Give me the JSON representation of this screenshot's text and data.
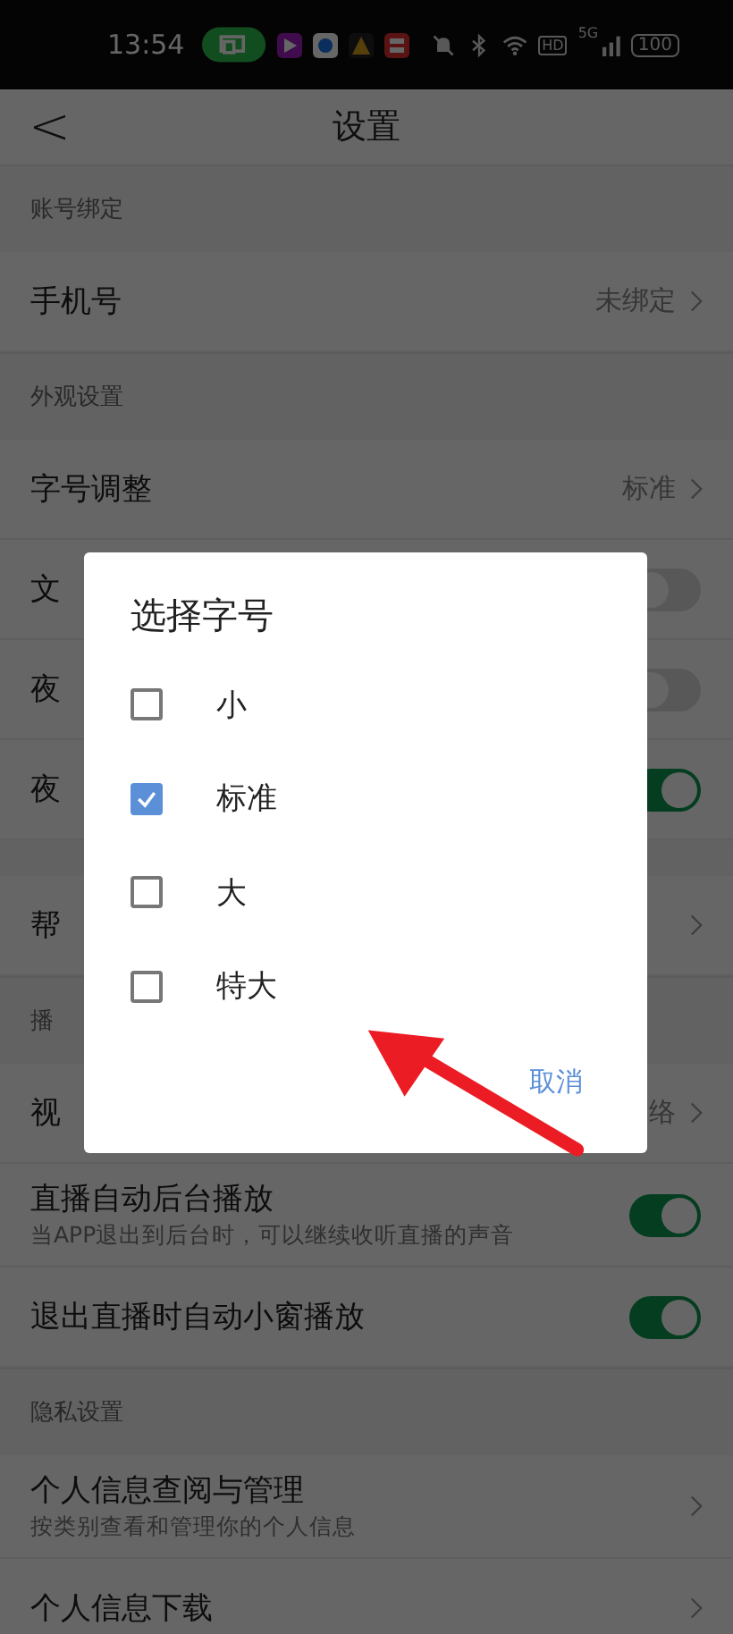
{
  "status_bar": {
    "time": "13:54",
    "hd": "HD",
    "network": "5G",
    "battery": "100"
  },
  "header": {
    "back": "<",
    "title": "设置"
  },
  "sections": [
    {
      "title": "账号绑定",
      "rows": [
        {
          "kind": "link",
          "label": "手机号",
          "value": "未绑定"
        }
      ]
    },
    {
      "title": "外观设置",
      "rows": [
        {
          "kind": "link",
          "label": "字号调整",
          "value": "标准"
        },
        {
          "kind": "toggle",
          "label": "文",
          "on": false
        },
        {
          "kind": "toggle",
          "label": "夜",
          "on": false
        },
        {
          "kind": "toggle",
          "label": "夜",
          "on": true
        }
      ]
    },
    {
      "rows": [
        {
          "kind": "link",
          "label": "帮"
        }
      ]
    },
    {
      "title": "播",
      "rows": [
        {
          "kind": "link",
          "label": "视",
          "value": "络"
        },
        {
          "kind": "toggle",
          "label": "直播自动后台播放",
          "sub": "当APP退出到后台时，可以继续收听直播的声音",
          "on": true
        },
        {
          "kind": "toggle",
          "label": "退出直播时自动小窗播放",
          "on": true
        }
      ]
    },
    {
      "title": "隐私设置",
      "rows": [
        {
          "kind": "link",
          "label": "个人信息查阅与管理",
          "sub": "按类别查看和管理你的个人信息"
        },
        {
          "kind": "link",
          "label": "个人信息下载"
        }
      ]
    }
  ],
  "dialog": {
    "title": "选择字号",
    "options": [
      {
        "label": "小",
        "selected": false
      },
      {
        "label": "标准",
        "selected": true
      },
      {
        "label": "大",
        "selected": false
      },
      {
        "label": "特大",
        "selected": false
      }
    ],
    "cancel": "取消"
  },
  "annotation": {
    "kind": "arrow"
  }
}
